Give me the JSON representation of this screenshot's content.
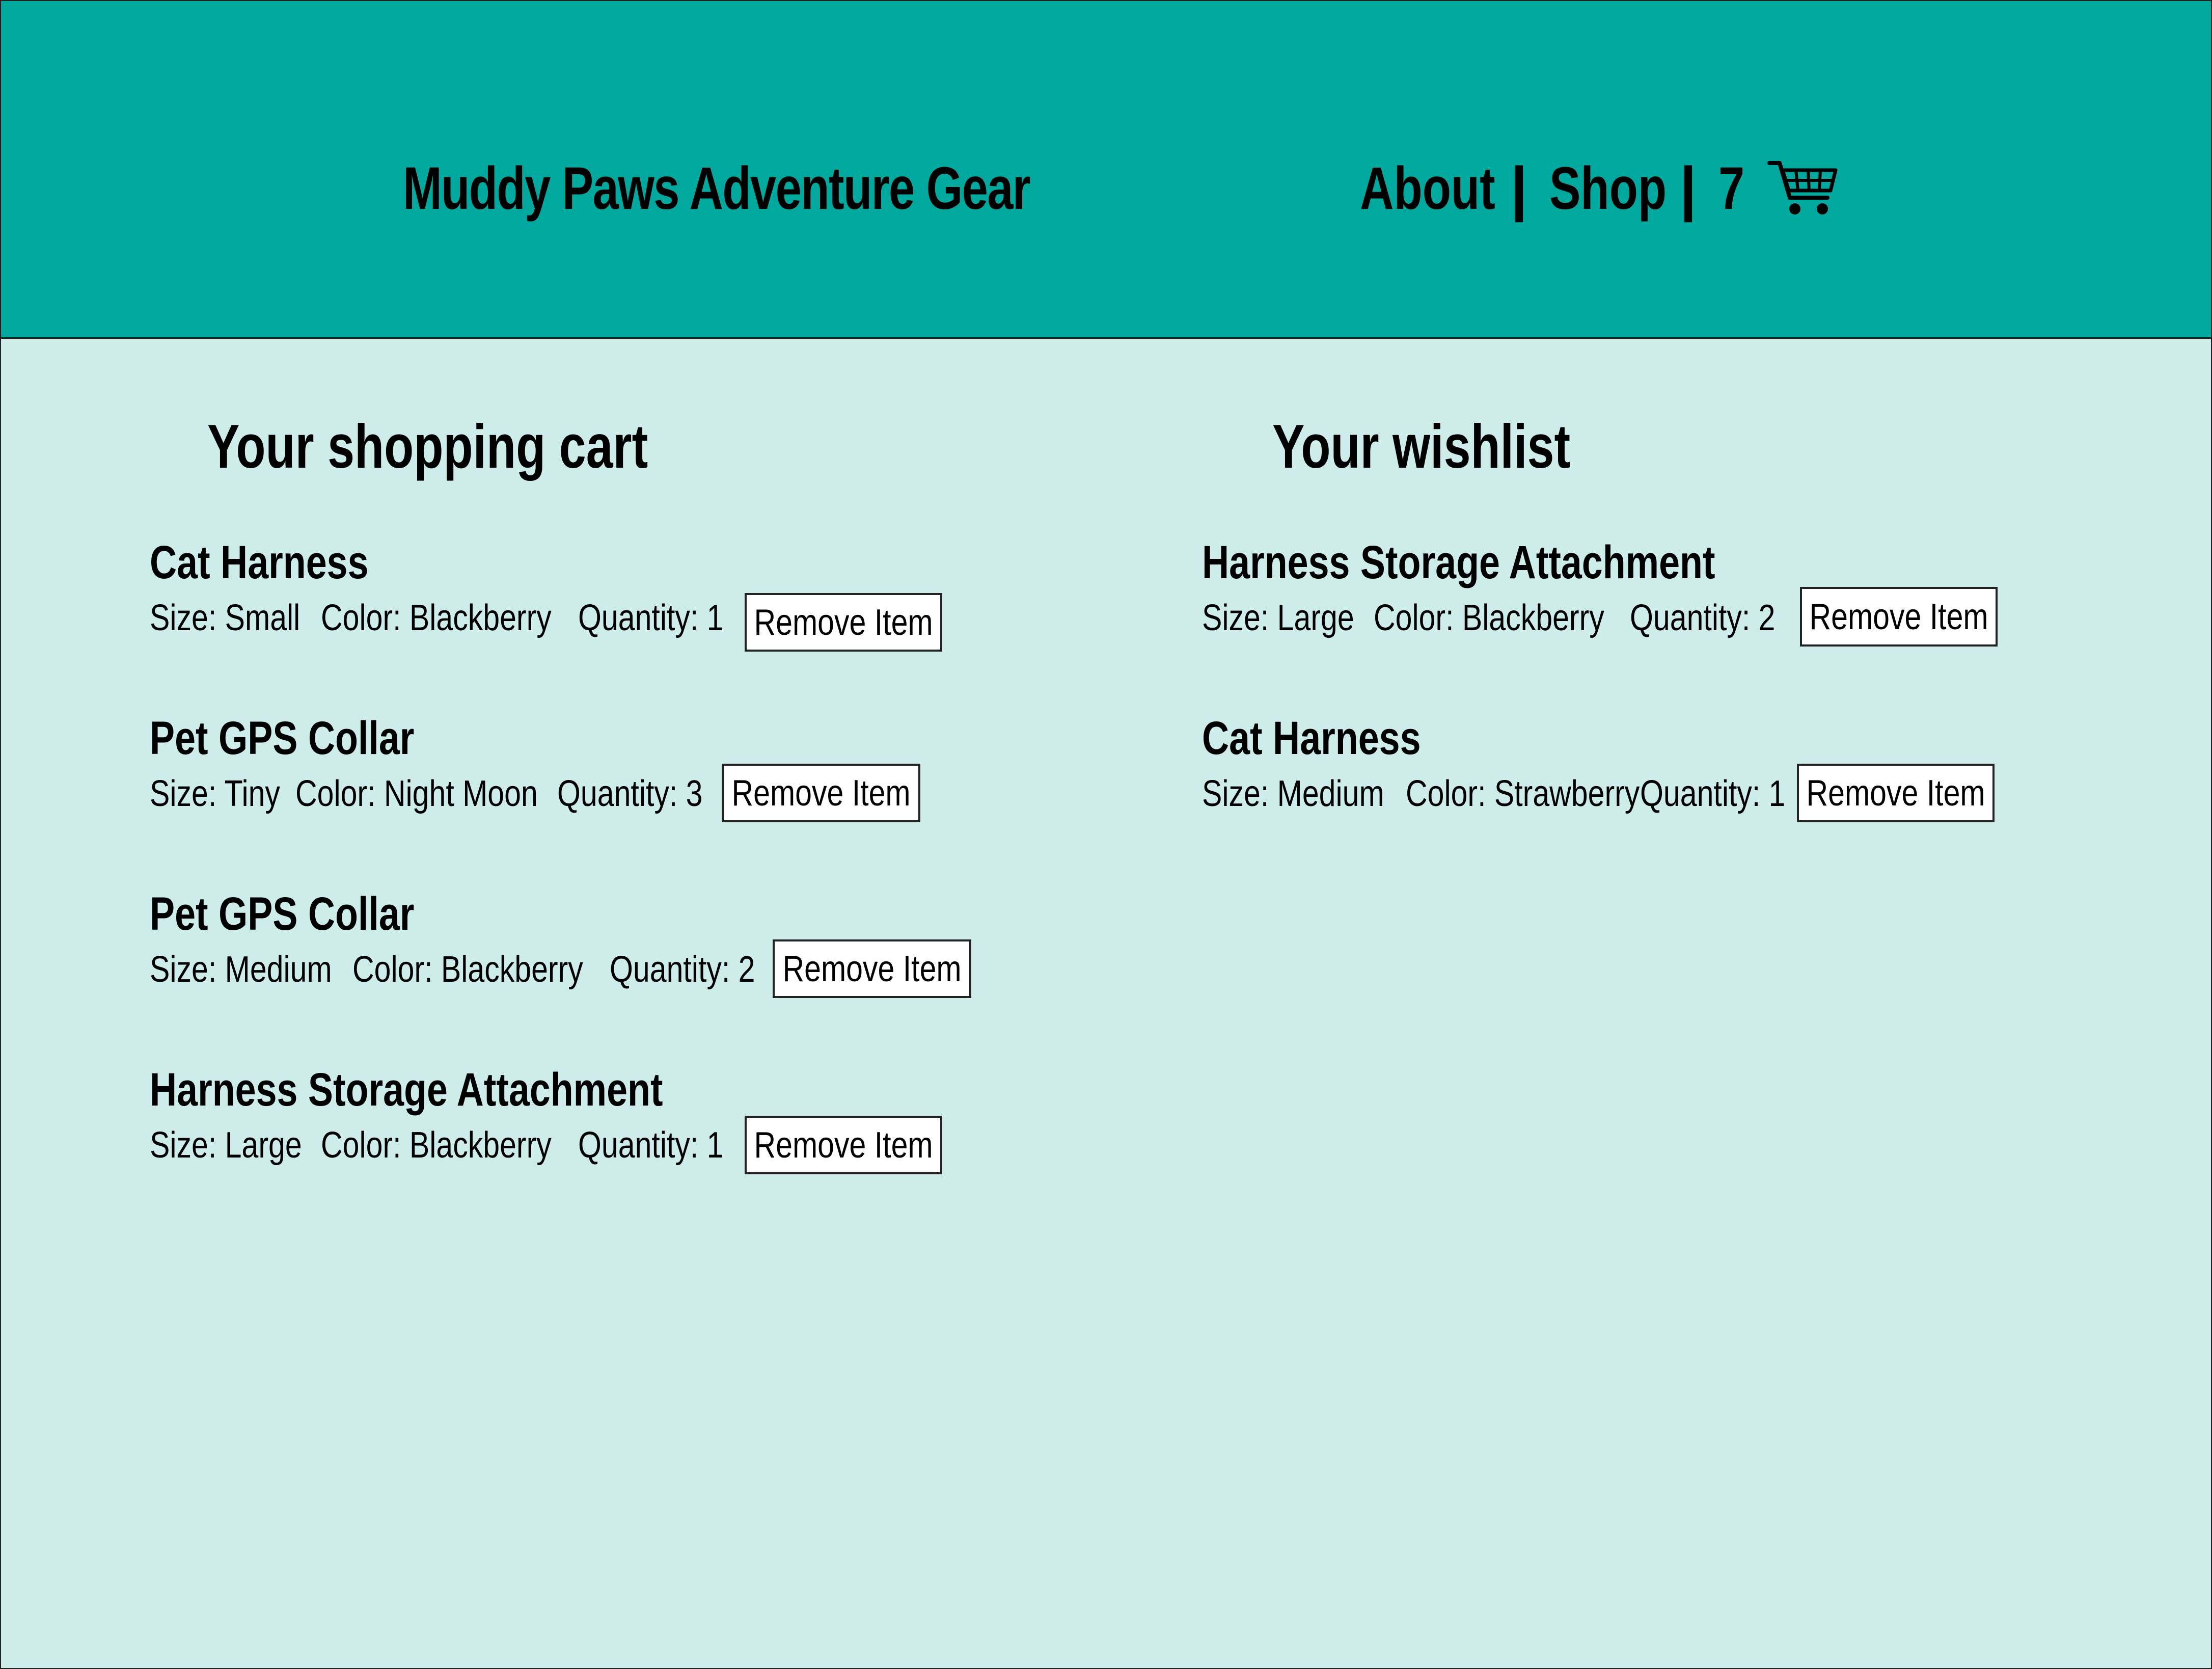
{
  "header": {
    "brand": "Muddy Paws Adventure Gear",
    "nav": {
      "about": "About",
      "separator": "|",
      "shop": "Shop",
      "cart_count": "7",
      "cart_icon": "shopping-cart-icon"
    }
  },
  "cart": {
    "title": "Your shopping cart",
    "items": [
      {
        "name": "Cat Harness",
        "size": "Size: Small",
        "color": "Color: Blackberry",
        "quantity": "Quantity: 1",
        "remove_label": "Remove Item"
      },
      {
        "name": "Pet GPS Collar",
        "size": "Size: Tiny",
        "color": "Color: Night Moon",
        "quantity": "Quantity: 3",
        "remove_label": "Remove Item"
      },
      {
        "name": "Pet GPS Collar",
        "size": "Size: Medium",
        "color": "Color: Blackberry",
        "quantity": "Quantity: 2",
        "remove_label": "Remove Item"
      },
      {
        "name": "Harness Storage Attachment",
        "size": "Size: Large",
        "color": "Color: Blackberry",
        "quantity": "Quantity: 1",
        "remove_label": "Remove Item"
      }
    ]
  },
  "wishlist": {
    "title": "Your wishlist",
    "items": [
      {
        "name": "Harness Storage Attachment",
        "size": "Size: Large",
        "color": "Color: Blackberry",
        "quantity": "Quantity: 2",
        "remove_label": "Remove Item"
      },
      {
        "name": "Cat Harness",
        "size": "Size: Medium",
        "color": "Color: Strawberry",
        "quantity": "Quantity: 1",
        "remove_label": "Remove Item"
      }
    ]
  },
  "colors": {
    "header_bg": "#00a89d",
    "page_bg": "#ceecea",
    "button_bg": "#ffffff",
    "border": "#222222"
  }
}
